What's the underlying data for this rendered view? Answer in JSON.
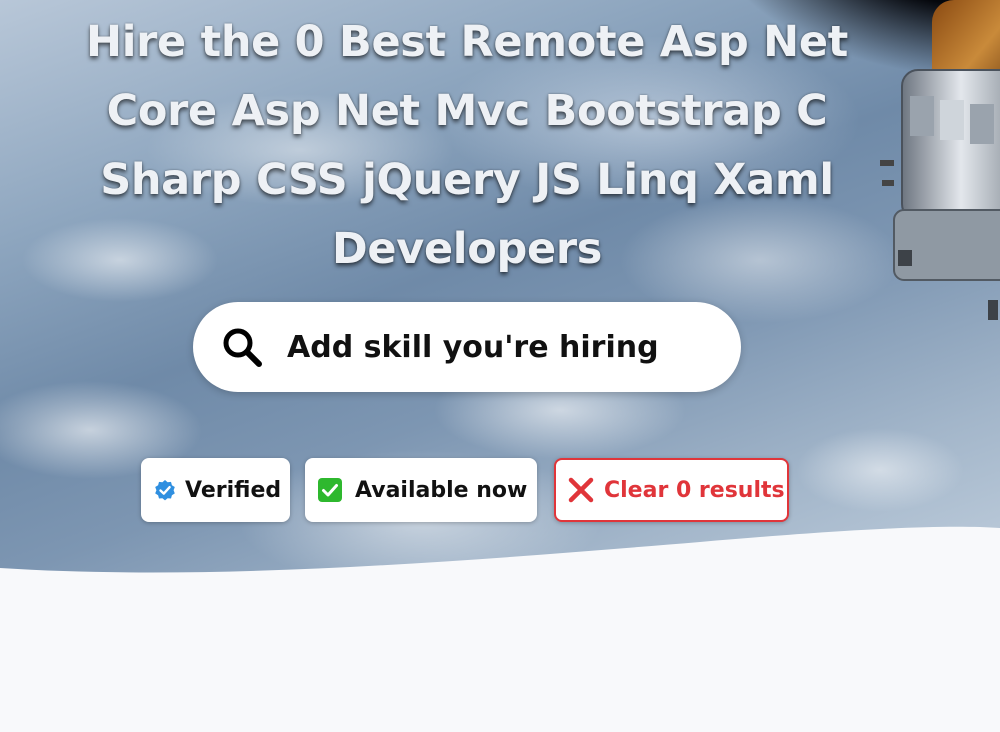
{
  "hero": {
    "headline": "Hire the 0 Best Remote Asp Net Core Asp Net Mvc Bootstrap C Sharp CSS jQuery JS Linq Xaml Developers"
  },
  "search": {
    "icon": "search-icon",
    "placeholder": "Add skill you're hiring"
  },
  "filters": {
    "verified": {
      "label": "Verified",
      "icon": "verified-badge-icon",
      "color": "#2f8fe0"
    },
    "available": {
      "label": "Available now",
      "icon": "check-box-icon",
      "color": "#2eb82e"
    },
    "clear": {
      "label": "Clear 0 results",
      "icon": "close-icon",
      "color": "#e0353a"
    }
  }
}
